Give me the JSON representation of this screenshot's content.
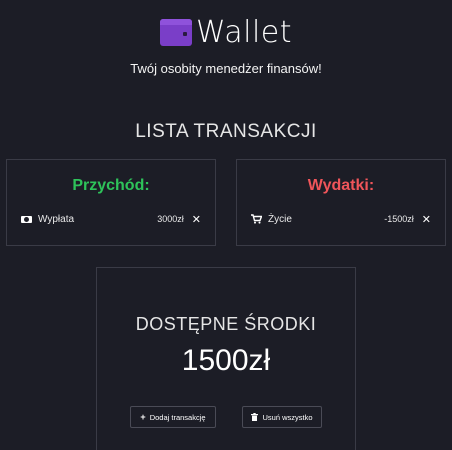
{
  "header": {
    "app_name": "Wallet",
    "subtitle": "Twój osobity menedżer finansów!",
    "logo_icon": "wallet-icon"
  },
  "transactions": {
    "title": "LISTA TRANSAKCJI",
    "income": {
      "heading": "Przychód:",
      "color": "#2ec35a",
      "items": [
        {
          "icon": "money-icon",
          "label": "Wypłata",
          "amount": "3000zł",
          "remove_icon": "close-icon"
        }
      ]
    },
    "expenses": {
      "heading": "Wydatki:",
      "color": "#f0555a",
      "items": [
        {
          "icon": "cart-icon",
          "label": "Życie",
          "amount": "-1500zł",
          "remove_icon": "close-icon"
        }
      ]
    }
  },
  "balance": {
    "label": "DOSTĘPNE ŚRODKI",
    "value": "1500zł",
    "add_button": "Dodaj transakcję",
    "clear_button": "Usuń wszystko"
  },
  "colors": {
    "background": "#1c1d26",
    "accent": "#7a3ec8"
  }
}
